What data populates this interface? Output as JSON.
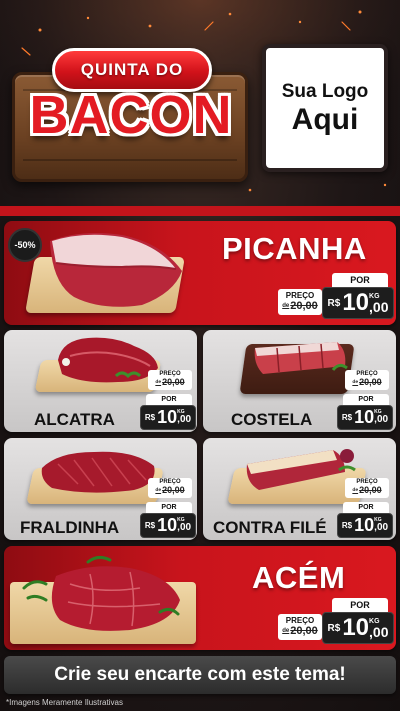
{
  "header": {
    "ribbon_text": "QUINTA DO",
    "title": "BACON",
    "logo_line1": "Sua Logo",
    "logo_line2": "Aqui"
  },
  "products": {
    "picanha": {
      "name": "PICANHA",
      "discount": "-50%",
      "preco_label": "PREÇO",
      "old_prefix": "de",
      "old_price": "20,00",
      "por_label": "POR",
      "currency": "R$",
      "price_int": "10",
      "price_dec": ",00",
      "unit": "KG"
    },
    "alcatra": {
      "name": "ALCATRA",
      "preco_label": "PREÇO",
      "old_prefix": "de",
      "old_price": "20,00",
      "por_label": "POR",
      "currency": "R$",
      "price_int": "10",
      "price_dec": ",00",
      "unit": "KG"
    },
    "costela": {
      "name": "COSTELA",
      "preco_label": "PREÇO",
      "old_prefix": "de",
      "old_price": "20,00",
      "por_label": "POR",
      "currency": "R$",
      "price_int": "10",
      "price_dec": ",00",
      "unit": "KG"
    },
    "fraldinha": {
      "name": "FRALDINHA",
      "preco_label": "PREÇO",
      "old_prefix": "de",
      "old_price": "20,00",
      "por_label": "POR",
      "currency": "R$",
      "price_int": "10",
      "price_dec": ",00",
      "unit": "KG"
    },
    "contra_file": {
      "name": "CONTRA FILÉ",
      "preco_label": "PREÇO",
      "old_prefix": "de",
      "old_price": "20,00",
      "por_label": "POR",
      "currency": "R$",
      "price_int": "10",
      "price_dec": ",00",
      "unit": "KG"
    },
    "acem": {
      "name": "ACÉM",
      "preco_label": "PREÇO",
      "old_prefix": "de",
      "old_price": "20,00",
      "por_label": "POR",
      "currency": "R$",
      "price_int": "10",
      "price_dec": ",00",
      "unit": "KG"
    }
  },
  "cta": {
    "label": "Crie seu encarte com este tema!"
  },
  "footer": {
    "disclaimer": "*Imagens Meramente Ilustrativas"
  },
  "colors": {
    "brand_red": "#c8141c",
    "dark": "#1d1d1d",
    "wood": "#6b4122"
  }
}
